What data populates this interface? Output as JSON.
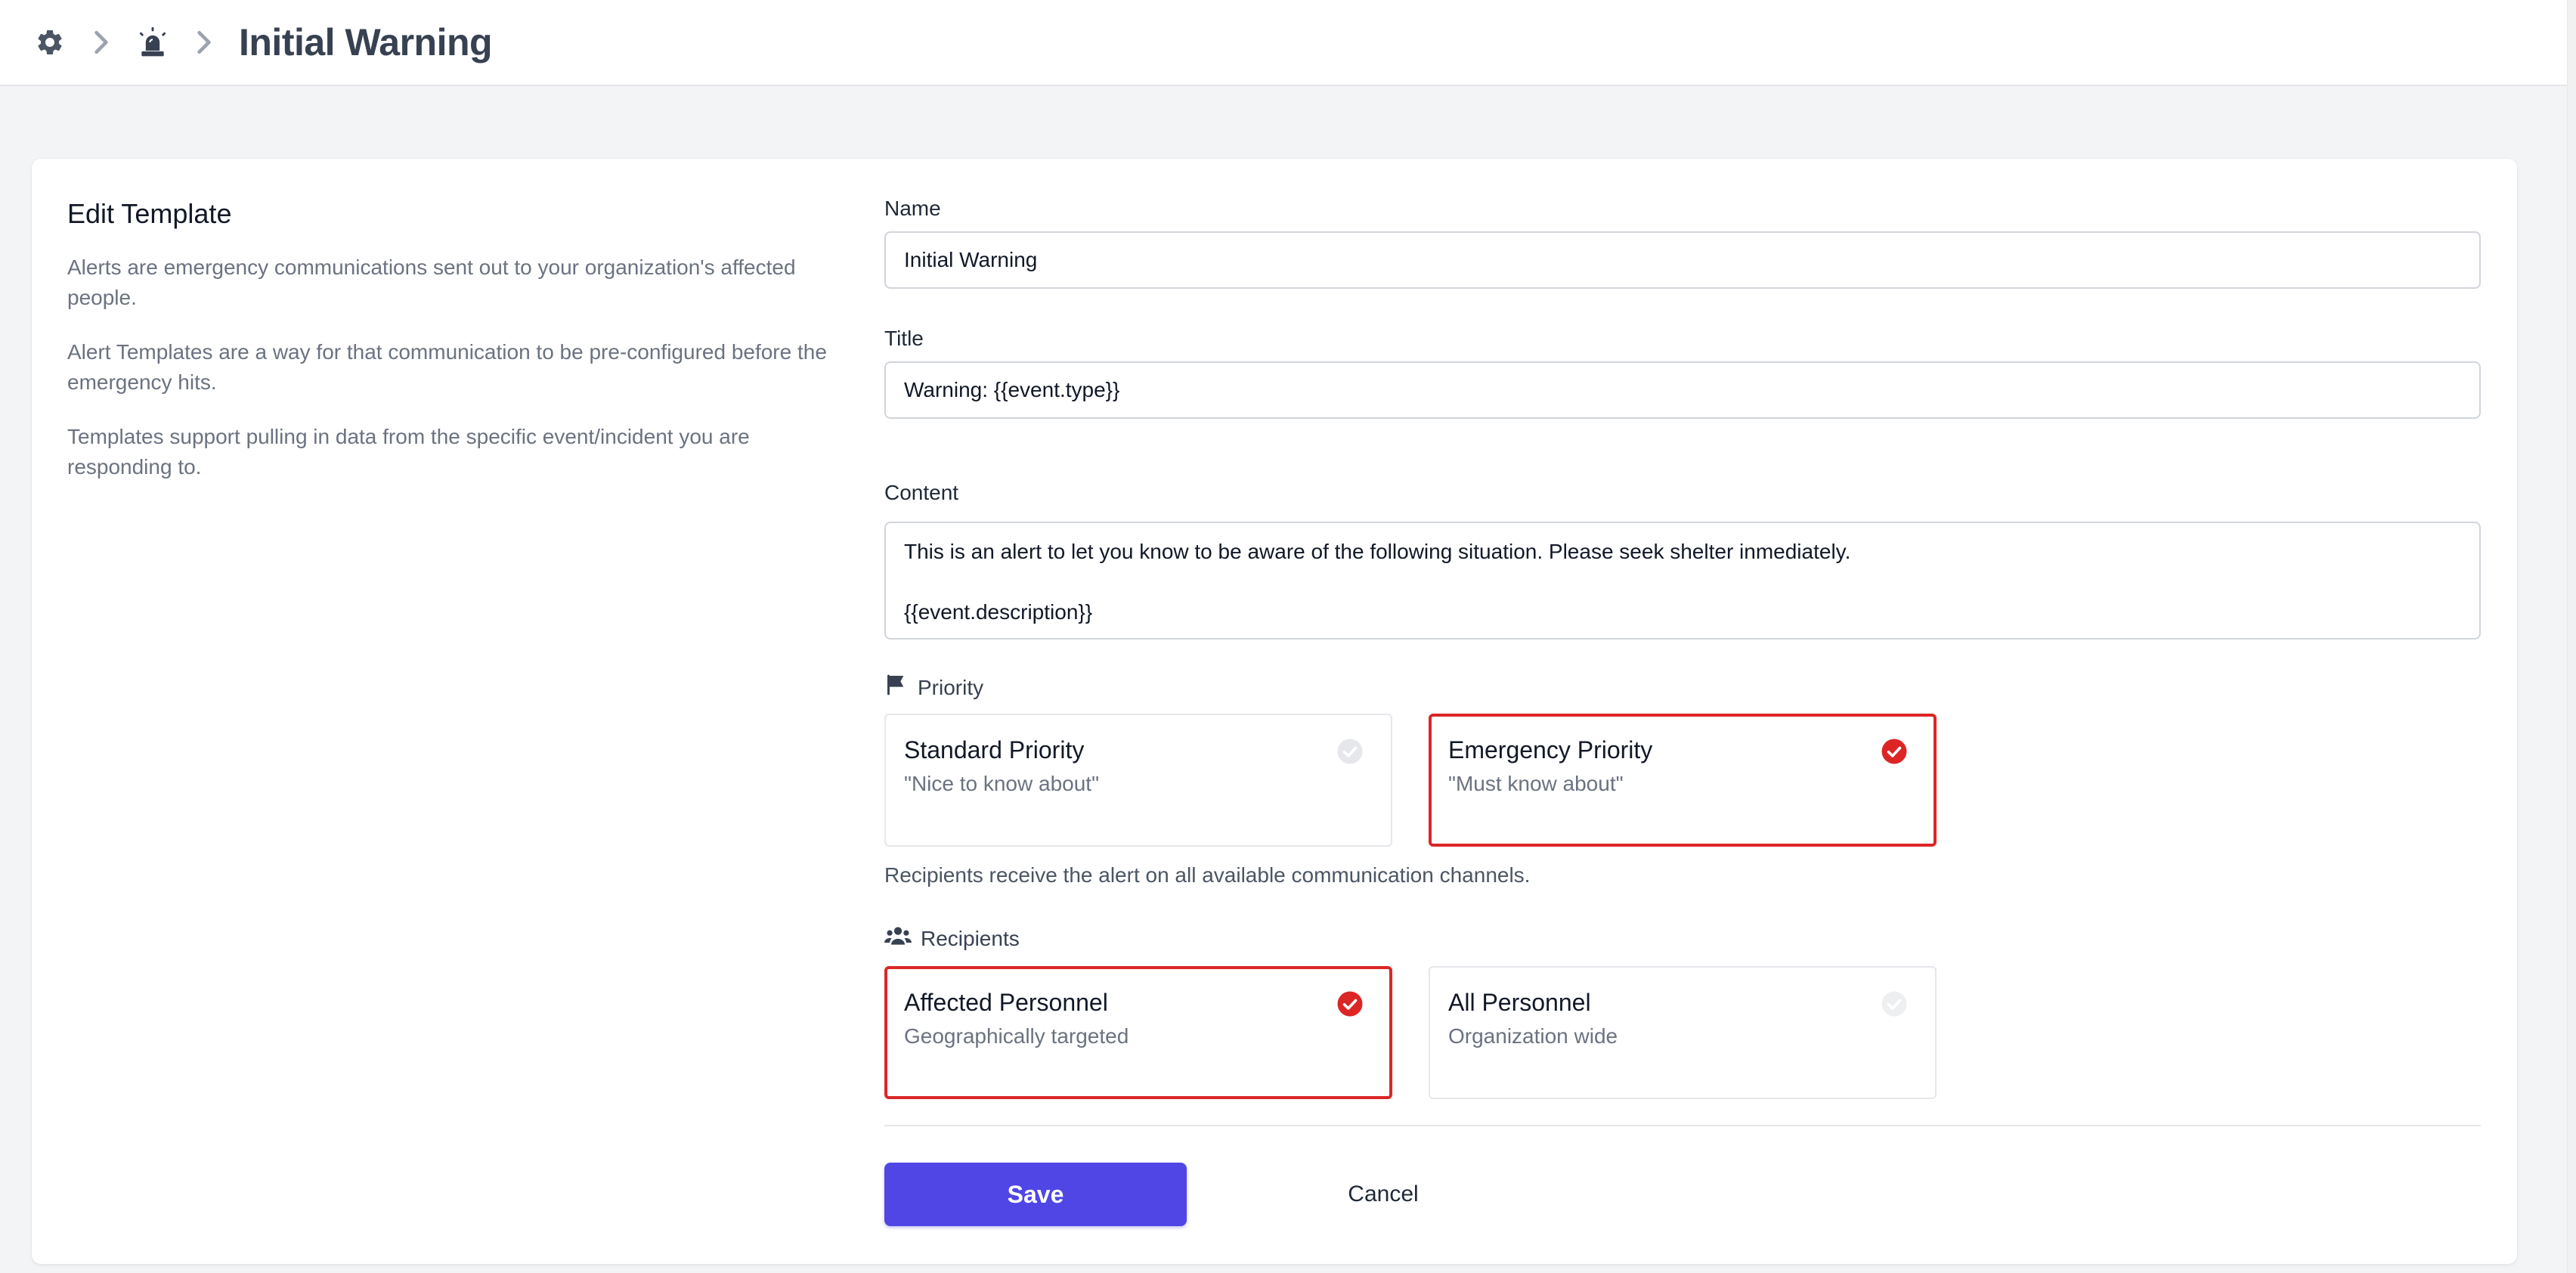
{
  "header": {
    "title": "Initial Warning",
    "icons": [
      "gear-icon",
      "chevron-right-icon",
      "siren-icon",
      "chevron-right-icon"
    ]
  },
  "sidebar": {
    "heading": "Edit Template",
    "paragraphs": [
      "Alerts are emergency communications sent out to your organization's affected people.",
      "Alert Templates are a way for that communication to be pre-configured before the emergency hits.",
      "Templates support pulling in data from the specific event/incident you are responding to."
    ]
  },
  "form": {
    "name_label": "Name",
    "name_value": "Initial Warning",
    "title_label": "Title",
    "title_value": "Warning: {{event.type}}",
    "content_label": "Content",
    "content_lines": [
      "This is an alert to let you know to be aware of the following situation. Please seek shelter inmediately.",
      "",
      "{{event.description}}"
    ],
    "priority": {
      "label": "Priority",
      "icon": "flag-icon",
      "options": [
        {
          "title": "Standard Priority",
          "subtitle": "\"Nice to know about\"",
          "selected": false
        },
        {
          "title": "Emergency Priority",
          "subtitle": "\"Must know about\"",
          "selected": true
        }
      ],
      "helper": "Recipients receive the alert on all available communication channels."
    },
    "recipients": {
      "label": "Recipients",
      "icon": "users-icon",
      "options": [
        {
          "title": "Affected Personnel",
          "subtitle": "Geographically targeted",
          "selected": true
        },
        {
          "title": "All Personnel",
          "subtitle": "Organization wide",
          "selected": false
        }
      ]
    },
    "save_label": "Save",
    "cancel_label": "Cancel"
  },
  "colors": {
    "accent": "#4f46e5",
    "selected_border": "#dc2626",
    "check_selected": "#dc2626",
    "check_unselected": "#e5e7eb"
  }
}
